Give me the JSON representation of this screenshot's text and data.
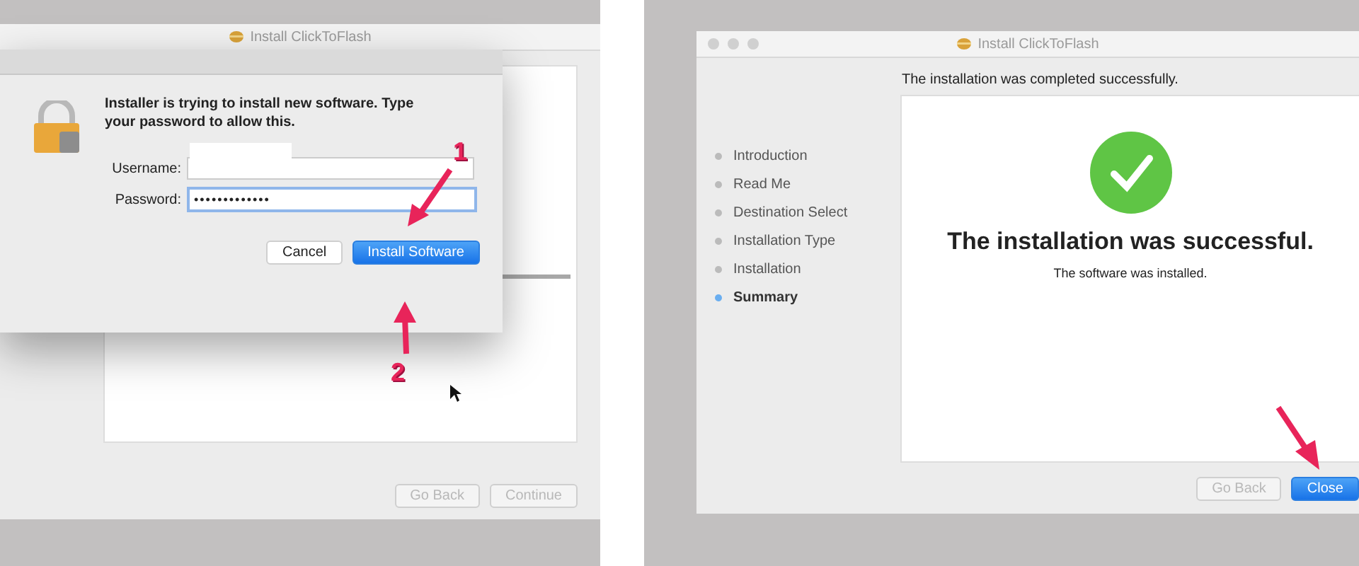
{
  "left_window": {
    "title": "Install ClickToFlash",
    "buttons": [
      {
        "label": "Go Back",
        "disabled": true
      },
      {
        "label": "Continue",
        "disabled": true
      }
    ]
  },
  "auth_dialog": {
    "message": "Installer is trying to install new software. Type your password to allow this.",
    "username_label": "Username:",
    "password_label": "Password:",
    "password_value": "•••••••••••••",
    "buttons": [
      {
        "label": "Cancel",
        "default": false
      },
      {
        "label": "Install Software",
        "default": true
      }
    ]
  },
  "annotations": [
    {
      "label": "1"
    },
    {
      "label": "2"
    }
  ],
  "right_window": {
    "title": "Install ClickToFlash",
    "header": "The installation was completed successfully.",
    "steps": [
      {
        "label": "Introduction",
        "selected": false
      },
      {
        "label": "Read Me",
        "selected": false
      },
      {
        "label": "Destination Select",
        "selected": false
      },
      {
        "label": "Installation Type",
        "selected": false
      },
      {
        "label": "Installation",
        "selected": false
      },
      {
        "label": "Summary",
        "selected": true
      }
    ],
    "heading": "The installation was successful.",
    "subtext": "The software was installed.",
    "buttons": [
      {
        "label": "Go Back",
        "default": false
      },
      {
        "label": "Close",
        "default": true
      }
    ]
  }
}
